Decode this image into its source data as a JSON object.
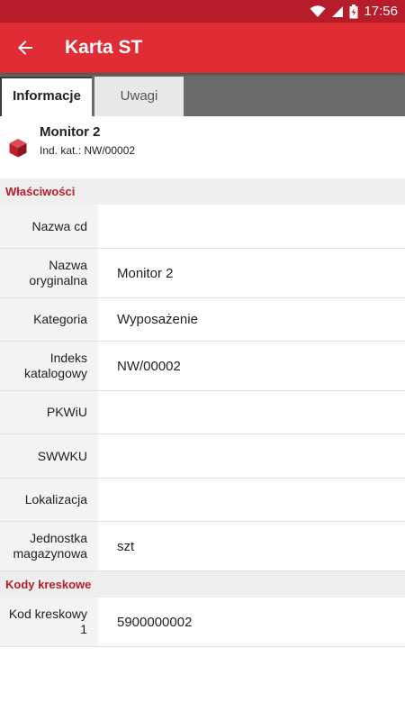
{
  "status_bar": {
    "time": "17:56"
  },
  "app_bar": {
    "title": "Karta ST"
  },
  "tabs": [
    {
      "label": "Informacje",
      "active": true
    },
    {
      "label": "Uwagi",
      "active": false
    }
  ],
  "item": {
    "name": "Monitor 2",
    "code": "Ind. kat.: NW/00002"
  },
  "properties": {
    "header": "Właściwości",
    "rows": [
      {
        "label": "Nazwa cd",
        "value": ""
      },
      {
        "label": "Nazwa oryginalna",
        "value": "Monitor 2"
      },
      {
        "label": "Kategoria",
        "value": "Wyposażenie"
      },
      {
        "label": "Indeks katalogowy",
        "value": "NW/00002"
      },
      {
        "label": "PKWiU",
        "value": ""
      },
      {
        "label": "SWWKU",
        "value": ""
      },
      {
        "label": "Lokalizacja",
        "value": ""
      },
      {
        "label": "Jednostka magazynowa",
        "value": "szt"
      }
    ]
  },
  "barcodes": {
    "header": "Kody kreskowe",
    "rows": [
      {
        "label": "Kod kreskowy 1",
        "value": "5900000002"
      }
    ]
  },
  "colors": {
    "status_bar": "#b71c2a",
    "app_bar": "#df2c35",
    "accent": "#b71c2a"
  }
}
